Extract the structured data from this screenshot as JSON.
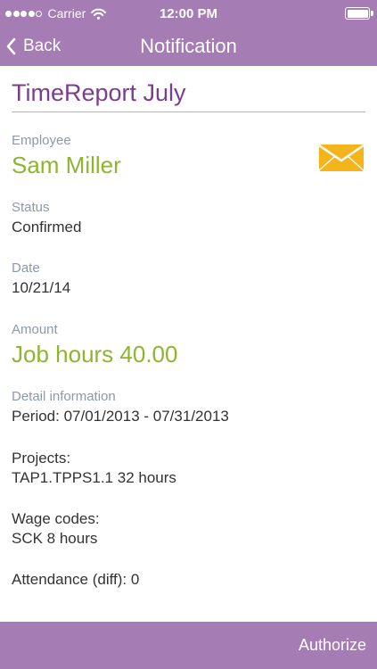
{
  "status_bar": {
    "carrier": "Carrier",
    "time": "12:00 PM",
    "signal_bars": 4,
    "signal_max": 5
  },
  "nav": {
    "back_label": "Back",
    "title": "Notification"
  },
  "report": {
    "title": "TimeReport July"
  },
  "fields": {
    "employee": {
      "label": "Employee",
      "value": "Sam Miller"
    },
    "status": {
      "label": "Status",
      "value": "Confirmed"
    },
    "date": {
      "label": "Date",
      "value": "10/21/14"
    },
    "amount": {
      "label": "Amount",
      "value": "Job hours 40.00"
    },
    "detail": {
      "label": "Detail information",
      "period": "Period: 07/01/2013 - 07/31/2013",
      "projects_label": "Projects:",
      "projects_value": "TAP1.TPPS1.1 32 hours",
      "wage_label": "Wage codes:",
      "wage_value": "SCK 8 hours",
      "attendance": "Attendance (diff): 0"
    }
  },
  "icons": {
    "mail": "envelope-icon",
    "back": "chevron-left-icon",
    "wifi": "wifi-icon",
    "battery": "battery-icon"
  },
  "colors": {
    "brand": "#a57cb3",
    "title": "#7a3f8c",
    "accent_green": "#8fb52e",
    "label_gray": "#8b99a8",
    "mail_yellow": "#f4b41a"
  },
  "footer": {
    "authorize_label": "Authorize"
  }
}
